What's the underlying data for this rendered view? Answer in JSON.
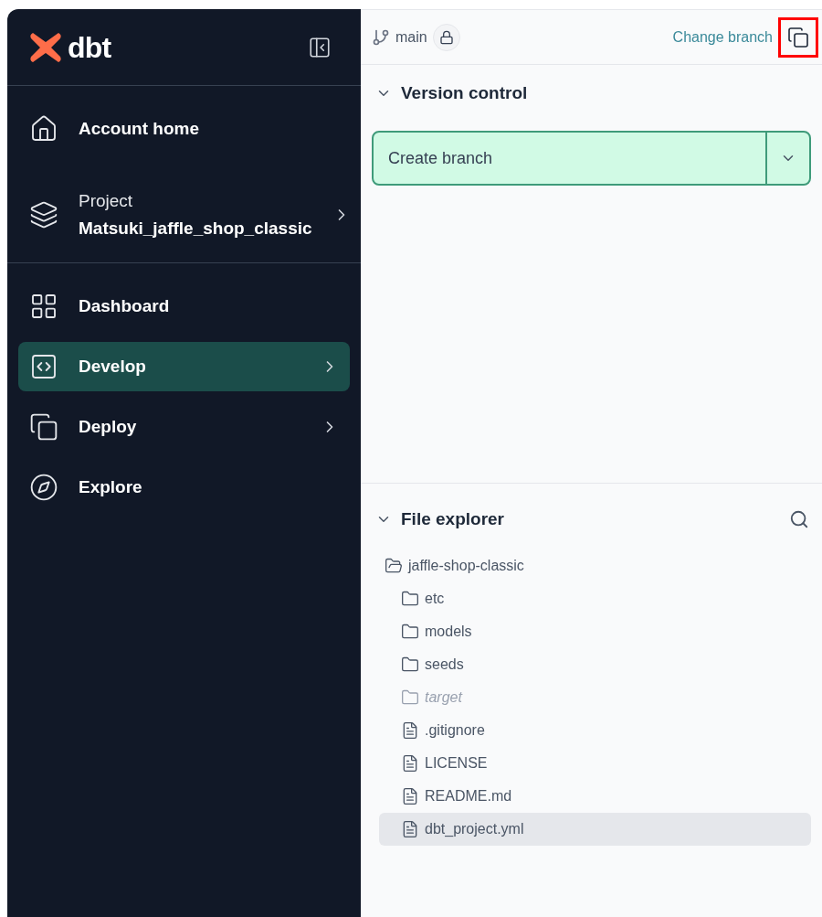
{
  "sidebar": {
    "logo": "dbt",
    "nav": [
      {
        "kind": "link",
        "label": "Account home",
        "selected": false,
        "chevron": false
      },
      {
        "kind": "project",
        "label": "Project",
        "value": "Matsuki_jaffle_shop_classic",
        "selected": false,
        "chevron": true
      },
      {
        "kind": "link",
        "label": "Dashboard",
        "selected": false,
        "chevron": false
      },
      {
        "kind": "link",
        "label": "Develop",
        "selected": true,
        "chevron": true
      },
      {
        "kind": "link",
        "label": "Deploy",
        "selected": false,
        "chevron": true
      },
      {
        "kind": "link",
        "label": "Explore",
        "selected": false,
        "chevron": false
      }
    ]
  },
  "branch_bar": {
    "branch": "main",
    "locked": true,
    "change_link": "Change branch",
    "copy_button": {
      "highlighted": true
    }
  },
  "version_control": {
    "title": "Version control",
    "expanded": true,
    "primary_button": "Create branch"
  },
  "file_explorer": {
    "title": "File explorer",
    "expanded": true,
    "tree": [
      {
        "kind": "folder",
        "name": "jaffle-shop-classic",
        "expanded": true,
        "ignored": false,
        "selected": false,
        "children": [
          {
            "kind": "folder",
            "name": "etc",
            "expanded": false,
            "ignored": false,
            "selected": false
          },
          {
            "kind": "folder",
            "name": "models",
            "expanded": false,
            "ignored": false,
            "selected": false
          },
          {
            "kind": "folder",
            "name": "seeds",
            "expanded": false,
            "ignored": false,
            "selected": false
          },
          {
            "kind": "folder",
            "name": "target",
            "expanded": false,
            "ignored": true,
            "selected": false
          },
          {
            "kind": "file",
            "name": ".gitignore",
            "ignored": false,
            "selected": false
          },
          {
            "kind": "file",
            "name": "LICENSE",
            "ignored": false,
            "selected": false
          },
          {
            "kind": "file",
            "name": "README.md",
            "ignored": false,
            "selected": false
          },
          {
            "kind": "file",
            "name": "dbt_project.yml",
            "ignored": false,
            "selected": true
          }
        ]
      }
    ]
  }
}
